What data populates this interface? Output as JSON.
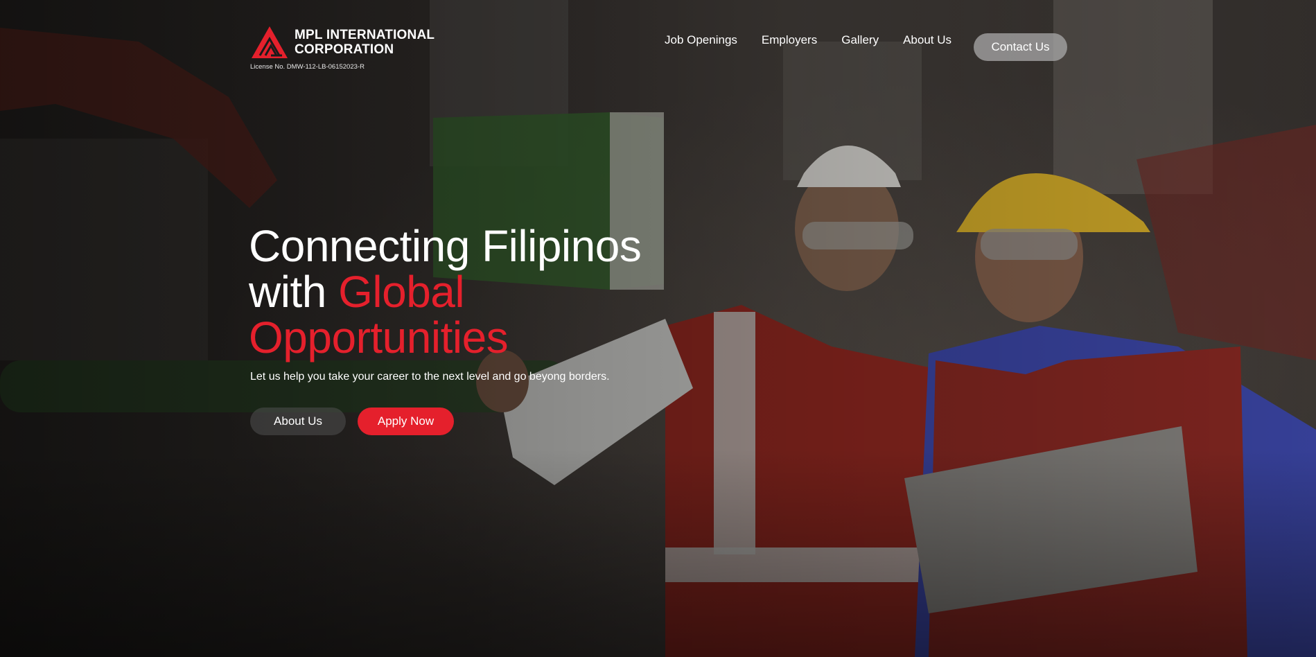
{
  "brand": {
    "name_line1": "MPL INTERNATIONAL",
    "name_line2": "CORPORATION",
    "license": "License No. DMW-112-LB-06152023-R",
    "logo_icon": "mpl-triangle-logo-icon",
    "accent_color": "#e5202c"
  },
  "nav": {
    "items": [
      {
        "label": "Job Openings"
      },
      {
        "label": "Employers"
      },
      {
        "label": "Gallery"
      },
      {
        "label": "About Us"
      }
    ],
    "contact_label": "Contact Us"
  },
  "hero": {
    "headline_part1": "Connecting Filipinos",
    "headline_part2": "with ",
    "headline_accent1": "Global",
    "headline_accent2": "Opportunities",
    "subtext": "Let us help you take your career to the next level and go beyong borders.",
    "about_button": "About Us",
    "apply_button": "Apply Now"
  }
}
